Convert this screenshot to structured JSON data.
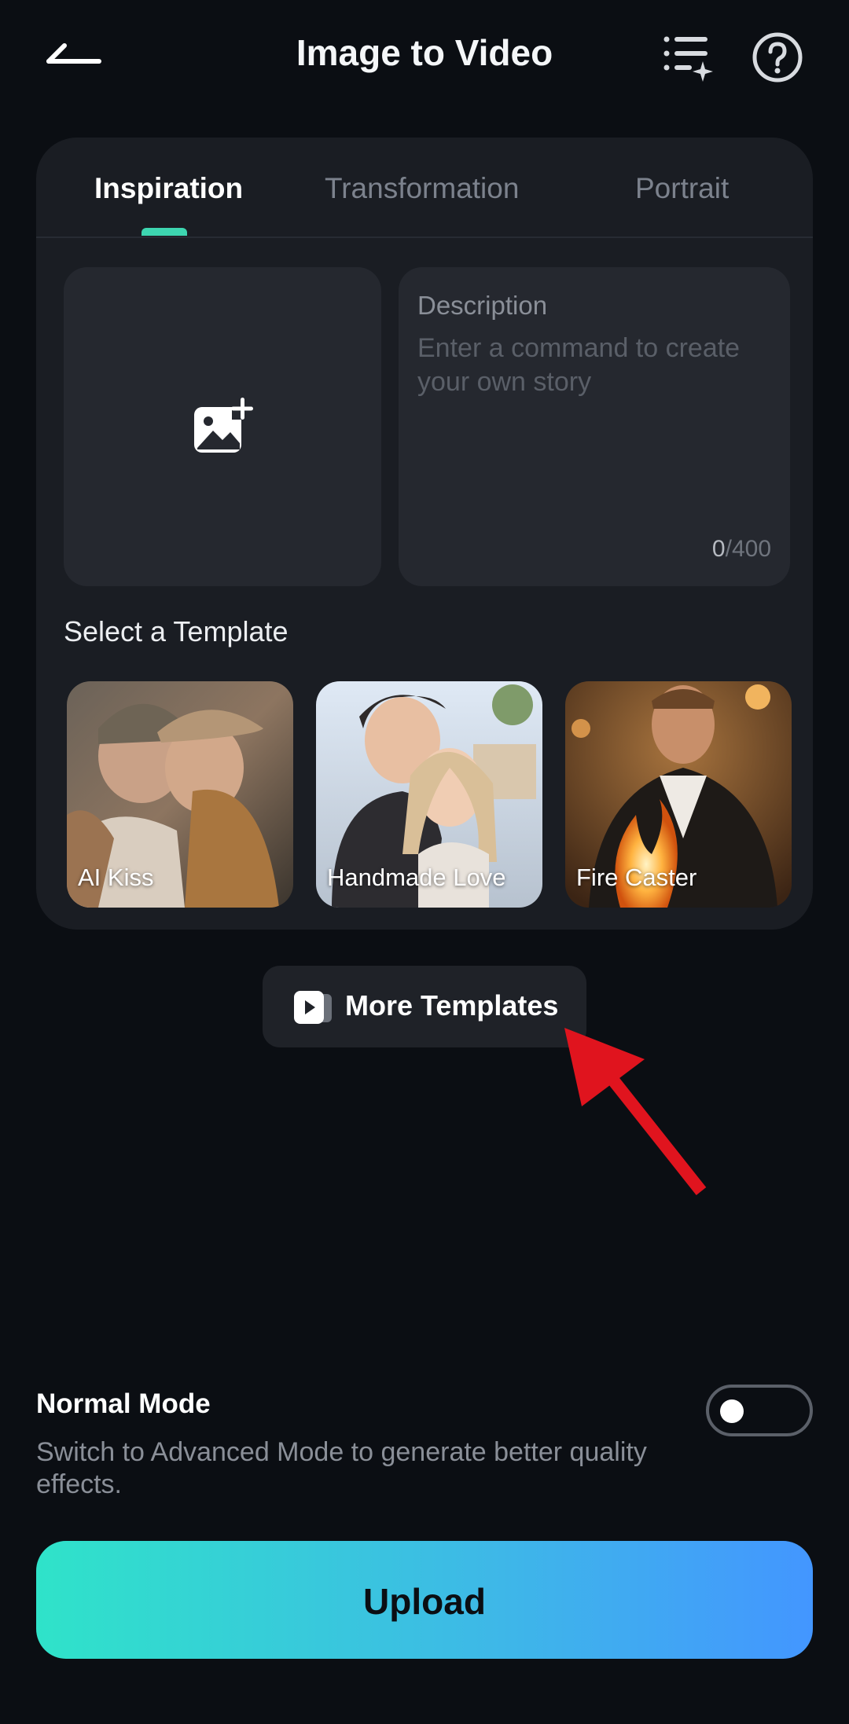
{
  "header": {
    "title": "Image to Video",
    "back_icon": "back-arrow-icon",
    "list_icon": "sparkle-list-icon",
    "help_icon": "help-circle-icon"
  },
  "tabs": [
    {
      "label": "Inspiration",
      "active": true
    },
    {
      "label": "Transformation",
      "active": false
    },
    {
      "label": "Portrait",
      "active": false
    }
  ],
  "upload_box": {
    "icon": "add-image-icon"
  },
  "description": {
    "label": "Description",
    "placeholder": "Enter a command to create your own story",
    "count_current": "0",
    "count_max": "/400"
  },
  "templates": {
    "section_title": "Select a Template",
    "items": [
      {
        "label": "AI Kiss"
      },
      {
        "label": "Handmade Love"
      },
      {
        "label": "Fire Caster"
      }
    ]
  },
  "more_templates": {
    "label": "More Templates",
    "icon": "video-template-icon"
  },
  "annotation": {
    "color": "#e0141e",
    "icon": "red-pointer-arrow"
  },
  "mode": {
    "title": "Normal Mode",
    "description": "Switch to Advanced Mode to generate better quality effects.",
    "toggle_on": false
  },
  "upload_button": {
    "label": "Upload"
  },
  "colors": {
    "accent": "#3dd6b0",
    "gradient_start": "#2fe3c9",
    "gradient_end": "#4396ff",
    "background": "#0b0e13"
  }
}
